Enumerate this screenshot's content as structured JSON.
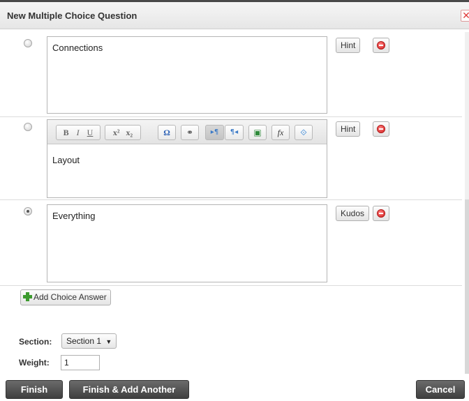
{
  "dialog": {
    "title": "New Multiple Choice Question",
    "close_glyph": "✕"
  },
  "choices": [
    {
      "text": "Connections",
      "selected": false,
      "side_label": "Hint"
    },
    {
      "text": "Layout",
      "selected": false,
      "side_label": "Hint",
      "has_toolbar": true
    },
    {
      "text": "Everything",
      "selected": true,
      "side_label": "Kudos"
    }
  ],
  "toolbar": {
    "bold": "B",
    "italic": "I",
    "underline": "U",
    "superscript": "x²",
    "subscript": "x₂",
    "special_char": "Ω",
    "link": "⚭",
    "ltr": "▸¶",
    "rtl": "¶◂",
    "image": "▣",
    "formula": "fx",
    "embed": "⟐"
  },
  "add_choice_label": "Add Choice Answer",
  "section": {
    "label": "Section:",
    "value": "Section 1",
    "arrow": "▼"
  },
  "weight": {
    "label": "Weight:",
    "value": "1"
  },
  "footer": {
    "finish": "Finish",
    "finish_add": "Finish & Add Another",
    "cancel": "Cancel"
  }
}
